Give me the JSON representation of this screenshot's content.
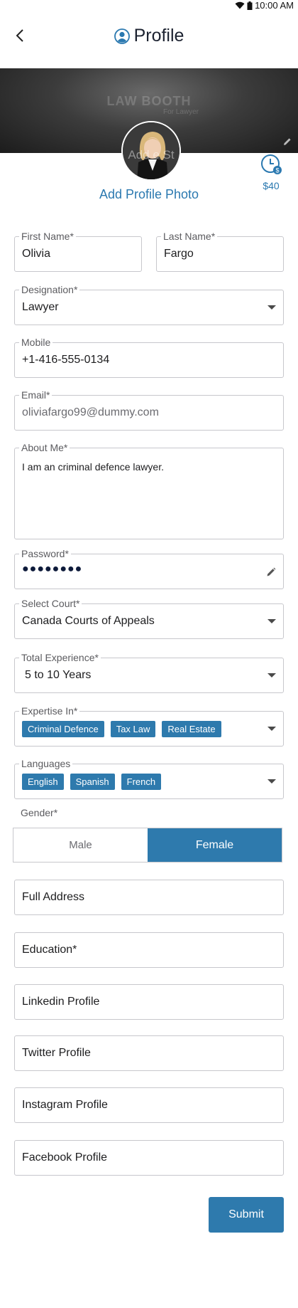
{
  "status": {
    "time": "10:00 AM"
  },
  "header": {
    "title": "Profile"
  },
  "banner": {
    "brand_left": "LAW",
    "brand_right": "BOOTH",
    "brand_sub": "For Lawyer"
  },
  "avatar": {
    "overlay_text": "Add e St"
  },
  "credits": {
    "value": "$40"
  },
  "add_photo_label": "Add Profile Photo",
  "form": {
    "first_name": {
      "label": "First Name*",
      "value": "Olivia"
    },
    "last_name": {
      "label": "Last Name*",
      "value": "Fargo"
    },
    "designation": {
      "label": "Designation*",
      "value": "Lawyer"
    },
    "mobile": {
      "label": "Mobile",
      "value": "+1-416-555-0134"
    },
    "email": {
      "label": "Email*",
      "value": "oliviafargo99@dummy.com"
    },
    "about": {
      "label": "About Me*",
      "value": "I am an criminal defence lawyer."
    },
    "password": {
      "label": "Password*",
      "value": "●●●●●●●●"
    },
    "court": {
      "label": "Select Court*",
      "value": "Canada Courts of Appeals"
    },
    "experience": {
      "label": "Total Experience*",
      "value": "5 to 10 Years"
    },
    "expertise": {
      "label": "Expertise In*",
      "chips": [
        "Criminal Defence",
        "Tax Law",
        "Real Estate"
      ]
    },
    "languages": {
      "label": "Languages",
      "chips": [
        "English",
        "Spanish",
        "French"
      ]
    },
    "gender": {
      "label": "Gender*",
      "options": [
        "Male",
        "Female"
      ],
      "selected": "Female"
    },
    "full_address": {
      "placeholder": "Full Address"
    },
    "education": {
      "placeholder": "Education*"
    },
    "linkedin": {
      "placeholder": "Linkedin Profile"
    },
    "twitter": {
      "placeholder": "Twitter Profile"
    },
    "instagram": {
      "placeholder": "Instagram Profile"
    },
    "facebook": {
      "placeholder": "Facebook Profile"
    }
  },
  "submit_label": "Submit",
  "colors": {
    "accent": "#2e7aad",
    "link": "#2b79b0",
    "border": "#c7c7cc"
  }
}
